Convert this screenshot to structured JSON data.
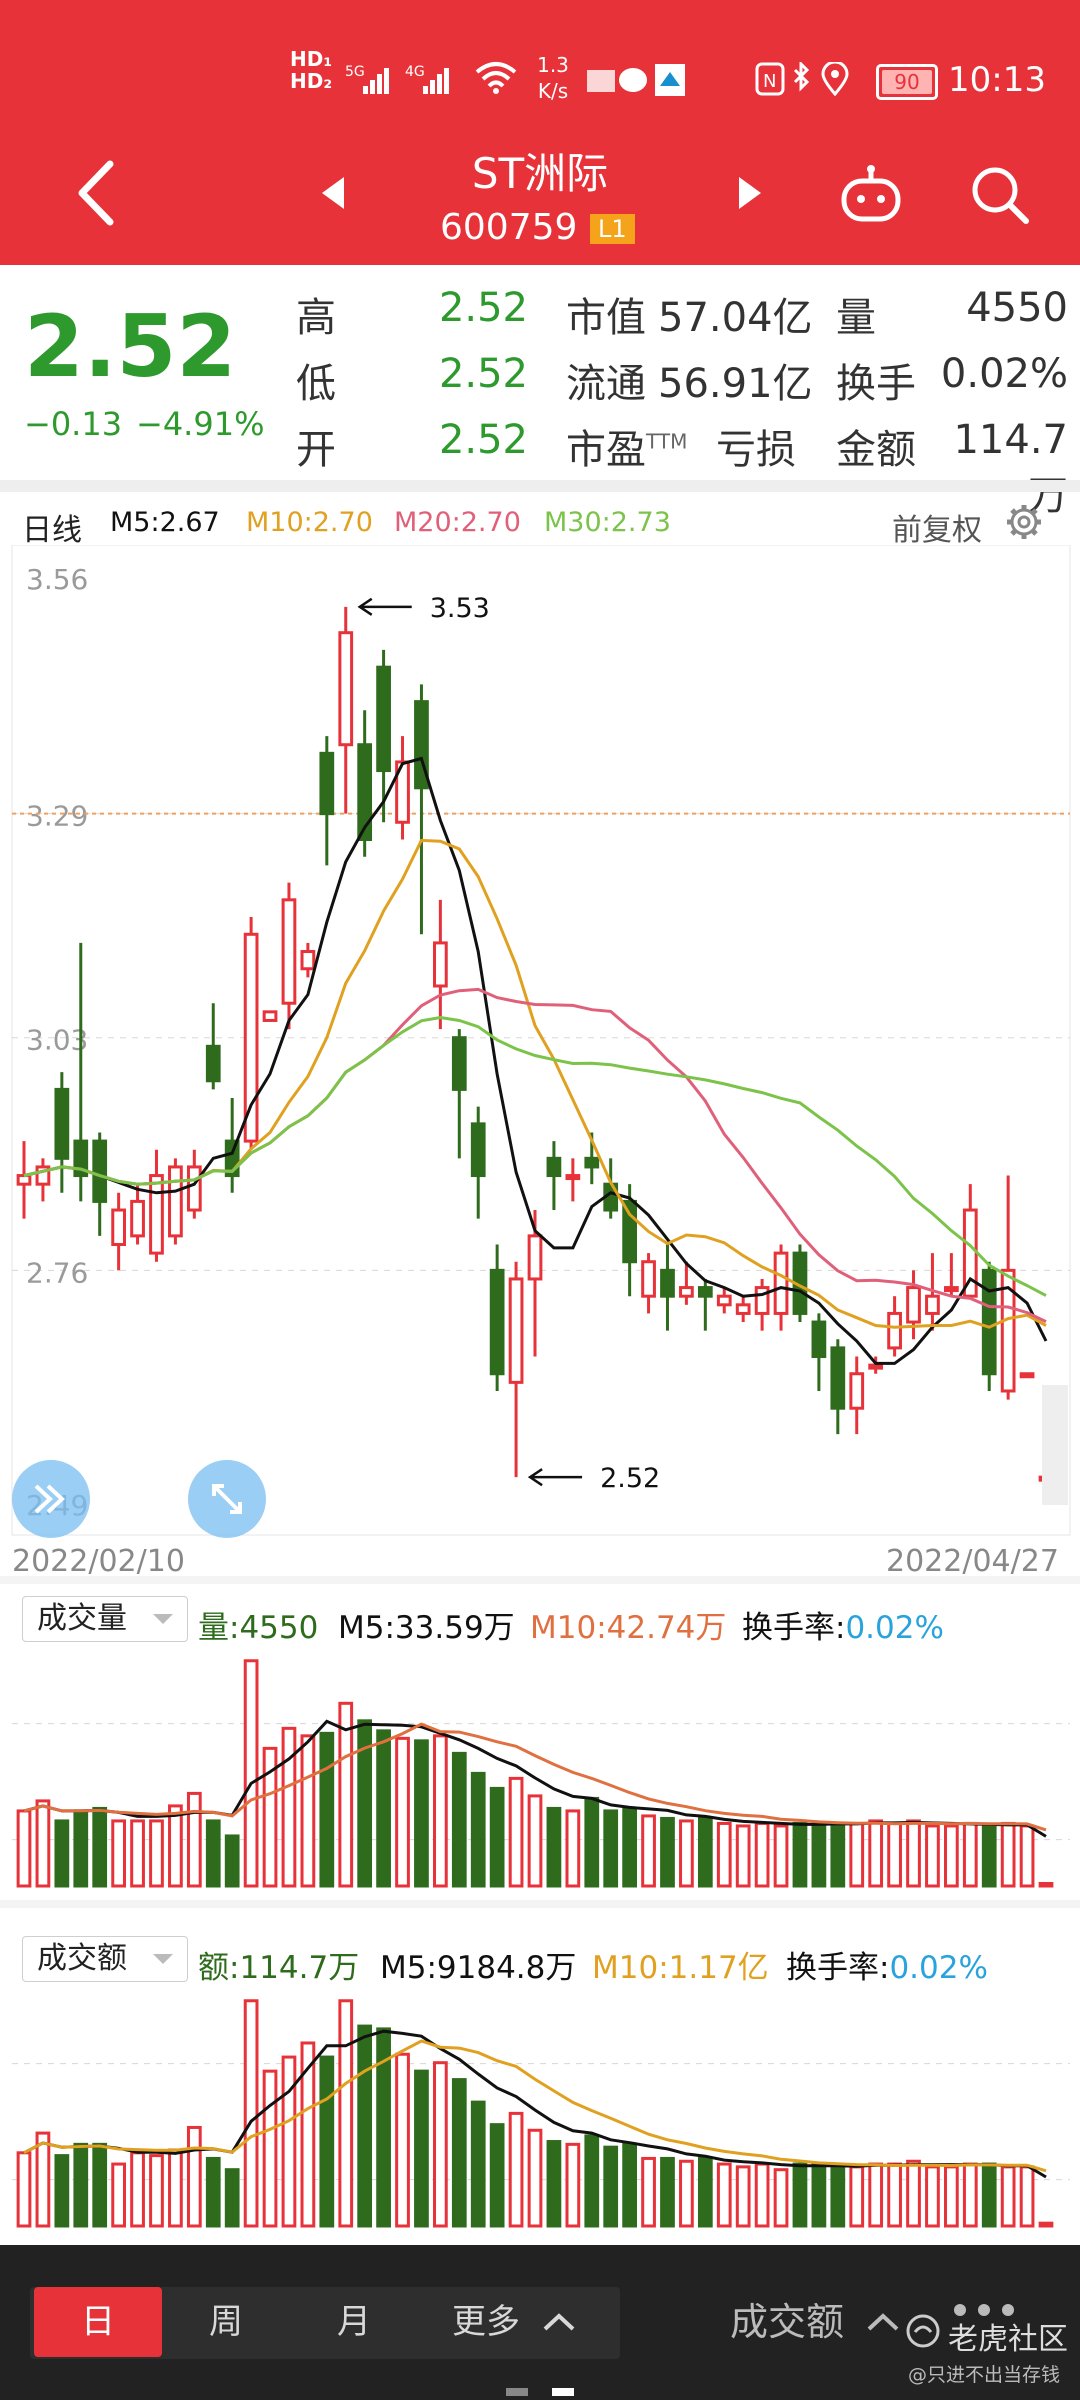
{
  "status_bar": {
    "network_speed": "1.3",
    "network_unit": "K/s",
    "battery": "90",
    "time": "10:13"
  },
  "header": {
    "stock_name": "ST洲际",
    "stock_code": "600759",
    "level_badge": "L1"
  },
  "quote": {
    "price": "2.52",
    "change": "−0.13",
    "change_pct": "−4.91%",
    "high_label": "高",
    "high": "2.52",
    "low_label": "低",
    "low": "2.52",
    "open_label": "开",
    "open": "2.52",
    "mkt_cap_label": "市值",
    "mkt_cap": "57.04亿",
    "float_label": "流通",
    "float": "56.91亿",
    "pe_label": "市盈",
    "pe_sup": "TTM",
    "pe": "亏损",
    "volume_label": "量",
    "volume": "4550",
    "turnover_label": "换手",
    "turnover": "0.02%",
    "amount_label": "金额",
    "amount": "114.7万"
  },
  "kline_header": {
    "period": "日线",
    "ma5": "M5:2.67",
    "ma10": "M10:2.70",
    "ma20": "M20:2.70",
    "ma30": "M30:2.73",
    "adjust": "前复权"
  },
  "colors": {
    "up": "#e63238",
    "down": "#2f6b1c",
    "ma5": "#111111",
    "ma10": "#e0a020",
    "ma20": "#e0607a",
    "ma30": "#7cc34a",
    "accent": "#e63238",
    "turnover_value": "#2aa3dd"
  },
  "volume_panel": {
    "selector": "成交量",
    "value": "量:4550",
    "ma5": "M5:33.59万",
    "ma10": "M10:42.74万",
    "turnover_label": "换手率:",
    "turnover_value": "0.02%"
  },
  "amount_panel": {
    "selector": "成交额",
    "value": "额:114.7万",
    "ma5": "M5:9184.8万",
    "ma10": "M10:1.17亿",
    "turnover_label": "换手率:",
    "turnover_value": "0.02%"
  },
  "bottom_tabs": {
    "day": "日",
    "week": "周",
    "month": "月",
    "more": "更多",
    "indicator": "成交额",
    "watermark": "老虎社区",
    "watermark_sub": "@只进不出当存钱"
  },
  "chart_data": {
    "type": "candlestick",
    "y_ticks": [
      "3.56",
      "3.29",
      "3.03",
      "2.76",
      "2.49"
    ],
    "ylim": [
      2.49,
      3.56
    ],
    "x_start": "2022/02/10",
    "x_end": "2022/04/27",
    "annotations": [
      {
        "text": "3.53",
        "value": 3.53
      },
      {
        "text": "2.52",
        "value": 2.52
      }
    ],
    "reference_price": 3.29,
    "candles": [
      {
        "o": 2.86,
        "c": 2.87,
        "h": 2.91,
        "l": 2.82
      },
      {
        "o": 2.86,
        "c": 2.88,
        "h": 2.89,
        "l": 2.84
      },
      {
        "o": 2.97,
        "c": 2.89,
        "h": 2.99,
        "l": 2.85
      },
      {
        "o": 2.91,
        "c": 2.87,
        "h": 3.14,
        "l": 2.84
      },
      {
        "o": 2.91,
        "c": 2.84,
        "h": 2.92,
        "l": 2.8
      },
      {
        "o": 2.79,
        "c": 2.83,
        "h": 2.85,
        "l": 2.76
      },
      {
        "o": 2.8,
        "c": 2.84,
        "h": 2.86,
        "l": 2.79
      },
      {
        "o": 2.78,
        "c": 2.87,
        "h": 2.9,
        "l": 2.77
      },
      {
        "o": 2.8,
        "c": 2.88,
        "h": 2.89,
        "l": 2.79
      },
      {
        "o": 2.83,
        "c": 2.88,
        "h": 2.9,
        "l": 2.82
      },
      {
        "o": 3.02,
        "c": 2.98,
        "h": 3.07,
        "l": 2.97
      },
      {
        "o": 2.91,
        "c": 2.87,
        "h": 2.96,
        "l": 2.85
      },
      {
        "o": 2.91,
        "c": 3.15,
        "h": 3.17,
        "l": 2.9
      },
      {
        "o": 3.05,
        "c": 3.06,
        "h": 3.06,
        "l": 3.05
      },
      {
        "o": 3.07,
        "c": 3.19,
        "h": 3.21,
        "l": 3.04
      },
      {
        "o": 3.11,
        "c": 3.13,
        "h": 3.14,
        "l": 3.1
      },
      {
        "o": 3.36,
        "c": 3.29,
        "h": 3.38,
        "l": 3.23
      },
      {
        "o": 3.37,
        "c": 3.5,
        "h": 3.53,
        "l": 3.29
      },
      {
        "o": 3.37,
        "c": 3.26,
        "h": 3.41,
        "l": 3.24
      },
      {
        "o": 3.46,
        "c": 3.34,
        "h": 3.48,
        "l": 3.28
      },
      {
        "o": 3.28,
        "c": 3.35,
        "h": 3.38,
        "l": 3.26
      },
      {
        "o": 3.42,
        "c": 3.32,
        "h": 3.44,
        "l": 3.15
      },
      {
        "o": 3.09,
        "c": 3.14,
        "h": 3.19,
        "l": 3.04
      },
      {
        "o": 3.03,
        "c": 2.97,
        "h": 3.04,
        "l": 2.89
      },
      {
        "o": 2.93,
        "c": 2.87,
        "h": 2.95,
        "l": 2.82
      },
      {
        "o": 2.76,
        "c": 2.64,
        "h": 2.79,
        "l": 2.62
      },
      {
        "o": 2.63,
        "c": 2.75,
        "h": 2.77,
        "l": 2.52
      },
      {
        "o": 2.75,
        "c": 2.8,
        "h": 2.83,
        "l": 2.66
      },
      {
        "o": 2.89,
        "c": 2.87,
        "h": 2.91,
        "l": 2.83
      },
      {
        "o": 2.87,
        "c": 2.87,
        "h": 2.89,
        "l": 2.84
      },
      {
        "o": 2.89,
        "c": 2.88,
        "h": 2.92,
        "l": 2.86
      },
      {
        "o": 2.86,
        "c": 2.83,
        "h": 2.89,
        "l": 2.82
      },
      {
        "o": 2.84,
        "c": 2.77,
        "h": 2.86,
        "l": 2.73
      },
      {
        "o": 2.73,
        "c": 2.77,
        "h": 2.78,
        "l": 2.71
      },
      {
        "o": 2.76,
        "c": 2.73,
        "h": 2.79,
        "l": 2.69
      },
      {
        "o": 2.73,
        "c": 2.74,
        "h": 2.77,
        "l": 2.72
      },
      {
        "o": 2.74,
        "c": 2.73,
        "h": 2.75,
        "l": 2.69
      },
      {
        "o": 2.72,
        "c": 2.73,
        "h": 2.74,
        "l": 2.71
      },
      {
        "o": 2.71,
        "c": 2.72,
        "h": 2.73,
        "l": 2.7
      },
      {
        "o": 2.71,
        "c": 2.74,
        "h": 2.75,
        "l": 2.69
      },
      {
        "o": 2.71,
        "c": 2.78,
        "h": 2.79,
        "l": 2.69
      },
      {
        "o": 2.78,
        "c": 2.71,
        "h": 2.79,
        "l": 2.7
      },
      {
        "o": 2.7,
        "c": 2.66,
        "h": 2.71,
        "l": 2.62
      },
      {
        "o": 2.67,
        "c": 2.6,
        "h": 2.68,
        "l": 2.57
      },
      {
        "o": 2.6,
        "c": 2.64,
        "h": 2.66,
        "l": 2.57
      },
      {
        "o": 2.65,
        "c": 2.65,
        "h": 2.66,
        "l": 2.64
      },
      {
        "o": 2.67,
        "c": 2.71,
        "h": 2.73,
        "l": 2.66
      },
      {
        "o": 2.7,
        "c": 2.74,
        "h": 2.76,
        "l": 2.68
      },
      {
        "o": 2.71,
        "c": 2.73,
        "h": 2.78,
        "l": 2.69
      },
      {
        "o": 2.74,
        "c": 2.74,
        "h": 2.78,
        "l": 2.73
      },
      {
        "o": 2.73,
        "c": 2.83,
        "h": 2.86,
        "l": 2.73
      },
      {
        "o": 2.76,
        "c": 2.64,
        "h": 2.77,
        "l": 2.62
      },
      {
        "o": 2.62,
        "c": 2.76,
        "h": 2.87,
        "l": 2.61
      },
      {
        "o": 2.64,
        "c": 2.64,
        "h": 2.64,
        "l": 2.64
      },
      {
        "o": 2.52,
        "c": 2.52,
        "h": 2.52,
        "l": 2.52
      }
    ],
    "volume": [
      30,
      34,
      26,
      30,
      31,
      26,
      26,
      26,
      32,
      37,
      26,
      20,
      90,
      55,
      63,
      60,
      61,
      73,
      66,
      62,
      59,
      58,
      60,
      53,
      45,
      39,
      43,
      36,
      31,
      30,
      35,
      30,
      31,
      28,
      27,
      26,
      27,
      25,
      24,
      25,
      24,
      25,
      25,
      25,
      25,
      26,
      25,
      26,
      24,
      24,
      25,
      24,
      25,
      24,
      1
    ],
    "amount": [
      26,
      33,
      25,
      29,
      29,
      22,
      26,
      25,
      27,
      35,
      24,
      20,
      80,
      55,
      60,
      65,
      60,
      80,
      71,
      70,
      61,
      55,
      58,
      52,
      44,
      36,
      40,
      34,
      30,
      29,
      32,
      28,
      29,
      24,
      24,
      23,
      24,
      22,
      21,
      22,
      20,
      22,
      22,
      21,
      21,
      22,
      22,
      23,
      21,
      21,
      22,
      22,
      21,
      21,
      1
    ]
  }
}
